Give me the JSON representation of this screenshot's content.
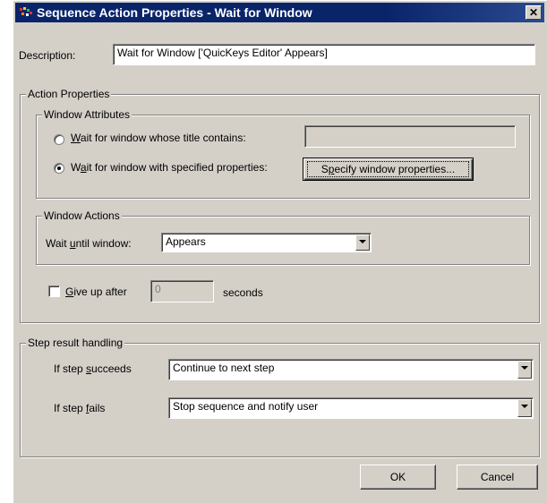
{
  "window": {
    "title": "Sequence Action Properties - Wait for Window",
    "close_glyph": "✕"
  },
  "description": {
    "label": "Description:",
    "value": "Wait for Window ['QuicKeys Editor' Appears]"
  },
  "action_properties": {
    "group_label": "Action Properties",
    "window_attributes": {
      "group_label": "Window Attributes",
      "option_title_pre": "",
      "option_title_u": "W",
      "option_title_post": "ait for window whose title contains:",
      "title_value": "",
      "option_props_pre": "W",
      "option_props_u": "a",
      "option_props_post": "it for window with specified properties:",
      "selected_option": "specified_properties",
      "specify_button_pre": "S",
      "specify_button_u": "p",
      "specify_button_post": "ecify window properties..."
    },
    "window_actions": {
      "group_label": "Window Actions",
      "wait_label_pre": "Wait ",
      "wait_label_u": "u",
      "wait_label_post": "ntil window:",
      "wait_value": "Appears"
    },
    "give_up": {
      "label_u": "G",
      "label_post": "ive up after",
      "checked": false,
      "value": "0",
      "unit": "seconds"
    }
  },
  "step_result": {
    "group_label": "Step result handling",
    "succeeds_label_pre": "If step ",
    "succeeds_label_u": "s",
    "succeeds_label_post": "ucceeds",
    "succeeds_value": "Continue to next step",
    "fails_label_pre": "If step ",
    "fails_label_u": "f",
    "fails_label_post": "ails",
    "fails_value": "Stop sequence and notify user"
  },
  "buttons": {
    "ok": "OK",
    "cancel": "Cancel"
  },
  "colors": {
    "titlebar": "#0a246a",
    "face": "#d4d0c8"
  }
}
